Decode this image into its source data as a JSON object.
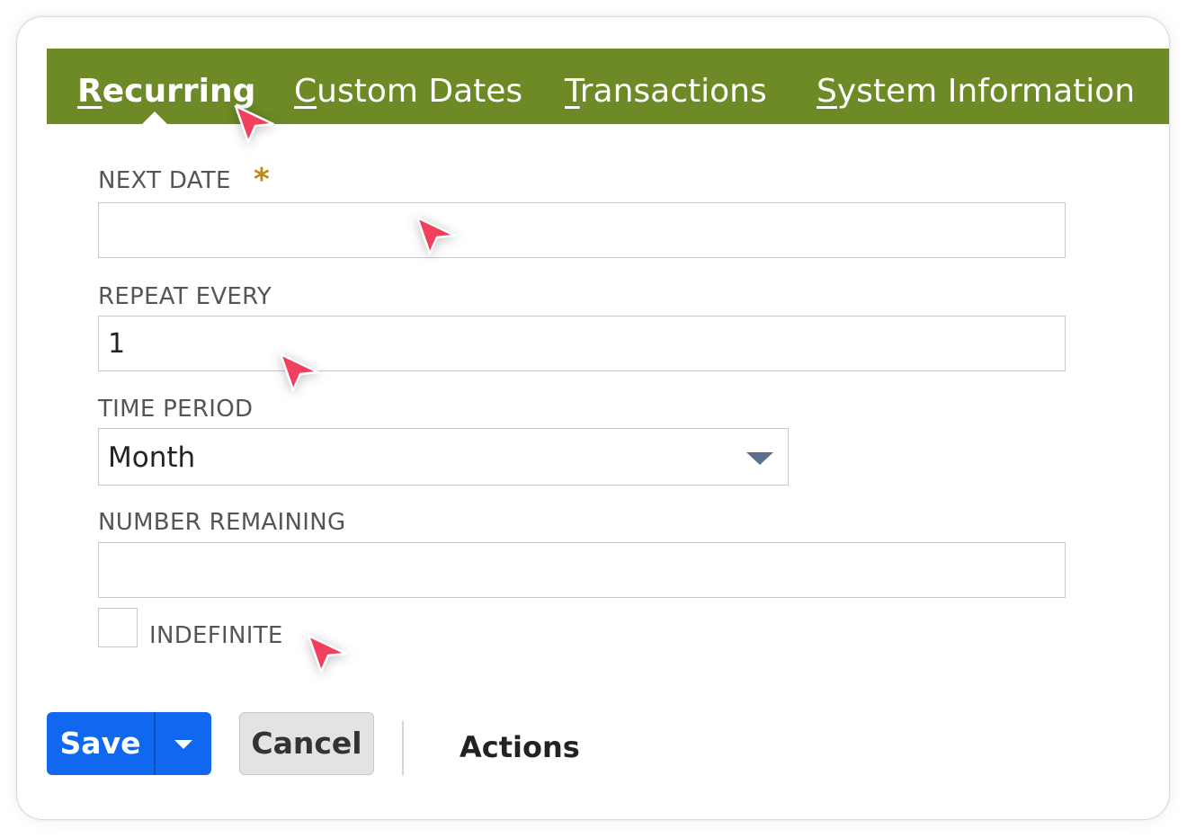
{
  "tabs": [
    {
      "prefix": "",
      "accel": "R",
      "rest": "ecurring",
      "active": true
    },
    {
      "prefix": "",
      "accel": "C",
      "rest": "ustom Dates",
      "active": false
    },
    {
      "prefix": "",
      "accel": "T",
      "rest": "ransactions",
      "active": false
    },
    {
      "prefix": "",
      "accel": "S",
      "rest": "ystem Information",
      "active": false
    }
  ],
  "form": {
    "next_date": {
      "label": "NEXT DATE",
      "required_mark": "*",
      "value": ""
    },
    "repeat_every": {
      "label": "REPEAT EVERY",
      "value": "1"
    },
    "time_period": {
      "label": "TIME PERIOD",
      "selected": "Month"
    },
    "number_remaining": {
      "label": "NUMBER REMAINING",
      "value": ""
    },
    "indefinite": {
      "label": "INDEFINITE",
      "checked": false
    }
  },
  "buttons": {
    "save": "Save",
    "cancel": "Cancel",
    "actions": "Actions"
  },
  "colors": {
    "tab_bar": "#6d8a26",
    "save_button": "#1068f0",
    "required_mark": "#c08712",
    "cursor": "#f0405e"
  },
  "icons": {
    "cursor": "mouse-pointer-icon",
    "dropdown": "chevron-down-icon"
  }
}
